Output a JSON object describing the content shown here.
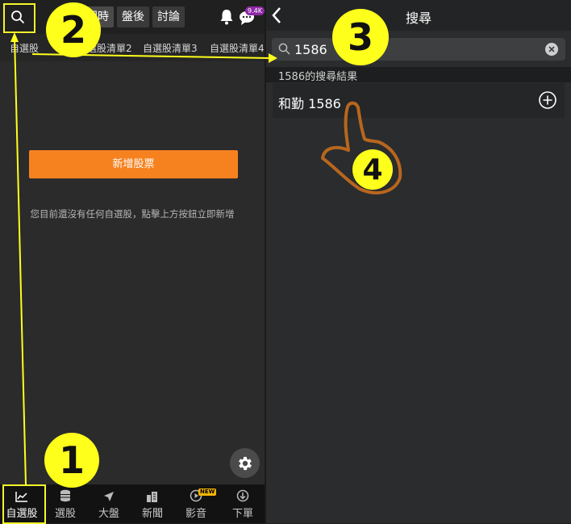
{
  "left": {
    "segments": [
      "即時",
      "盤後",
      "討論"
    ],
    "chat_badge": "9.4K",
    "watchlist_tabs": [
      "自選股",
      "自選股清單2",
      "自選股清單3",
      "自選股清單4"
    ],
    "add_button": "新增股票",
    "empty_message": "您目前還沒有任何自選股，點擊上方按鈕立即新增",
    "bottom_nav": [
      "自選股",
      "選股",
      "大盤",
      "新聞",
      "影音",
      "下單"
    ],
    "new_badge": "NEW"
  },
  "right": {
    "title": "搜尋",
    "search_value": "1586",
    "results_header": "1586的搜尋結果",
    "result_name": "和勤 1586"
  },
  "steps": [
    "1",
    "2",
    "3",
    "4"
  ],
  "colors": {
    "accent_orange": "#f6821f",
    "annotation_yellow": "#ffff1c",
    "hand_brown": "#b8661e"
  }
}
